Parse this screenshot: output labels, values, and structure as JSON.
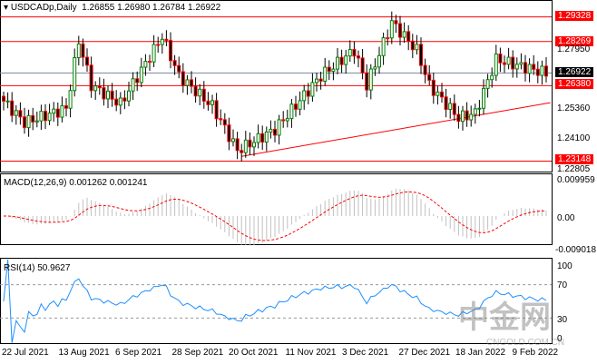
{
  "header": {
    "symbol": "USDCADp,Daily",
    "open": "1.26855",
    "high": "1.26980",
    "low": "1.26784",
    "close": "1.26922"
  },
  "chart_data": {
    "type": "candlestick",
    "title": "USDCADp,Daily",
    "price_keypoints": [
      [
        0,
        1.2572
      ],
      [
        5,
        1.248
      ],
      [
        15,
        1.254
      ],
      [
        18,
        1.283
      ],
      [
        21,
        1.264
      ],
      [
        28,
        1.256
      ],
      [
        38,
        1.285
      ],
      [
        42,
        1.268
      ],
      [
        50,
        1.255
      ],
      [
        56,
        1.236
      ],
      [
        65,
        1.245
      ],
      [
        76,
        1.268
      ],
      [
        84,
        1.279
      ],
      [
        87,
        1.264
      ],
      [
        93,
        1.291
      ],
      [
        99,
        1.279
      ],
      [
        102,
        1.264
      ],
      [
        109,
        1.25
      ],
      [
        113,
        1.252
      ],
      [
        118,
        1.275
      ],
      [
        130,
        1.2692
      ]
    ],
    "y_ticks": [
      "1.27950",
      "1.25360",
      "1.24100",
      "1.22805"
    ],
    "hlines": [
      {
        "label": "1.29328",
        "value": 1.29328
      },
      {
        "label": "1.28269",
        "value": 1.28269
      },
      {
        "label": "1.26380",
        "value": 1.2638
      },
      {
        "label": "1.23148",
        "value": 1.23148
      }
    ],
    "current_price": "1.26922",
    "trendline": {
      "from": [
        57,
        1.2335
      ],
      "to": [
        131,
        1.2565
      ]
    },
    "x_labels": [
      "22 Jul 2021",
      "13 Aug 2021",
      "6 Sep 2021",
      "28 Sep 2021",
      "20 Oct 2021",
      "11 Nov 2021",
      "3 Dec 2021",
      "27 Dec 2021",
      "18 Jan 2022",
      "9 Feb 2022"
    ],
    "macd": {
      "label": "MACD(12,26,9) 0.001262 0.001241",
      "ticks": [
        "0.009959",
        "0.00",
        "-0.009018"
      ]
    },
    "rsi": {
      "label": "RSI(14) 50.9627",
      "ticks": [
        "100",
        "70",
        "30",
        "0"
      ],
      "last": 50.96
    }
  },
  "watermark": {
    "text": "中金网",
    "sub": "CNGOLD.COM.CN"
  },
  "colors": {
    "up": "#008000",
    "down": "#ff0000",
    "hline": "#ff0000",
    "rsi": "#1e90ff",
    "macd_signal": "#ff0000"
  }
}
